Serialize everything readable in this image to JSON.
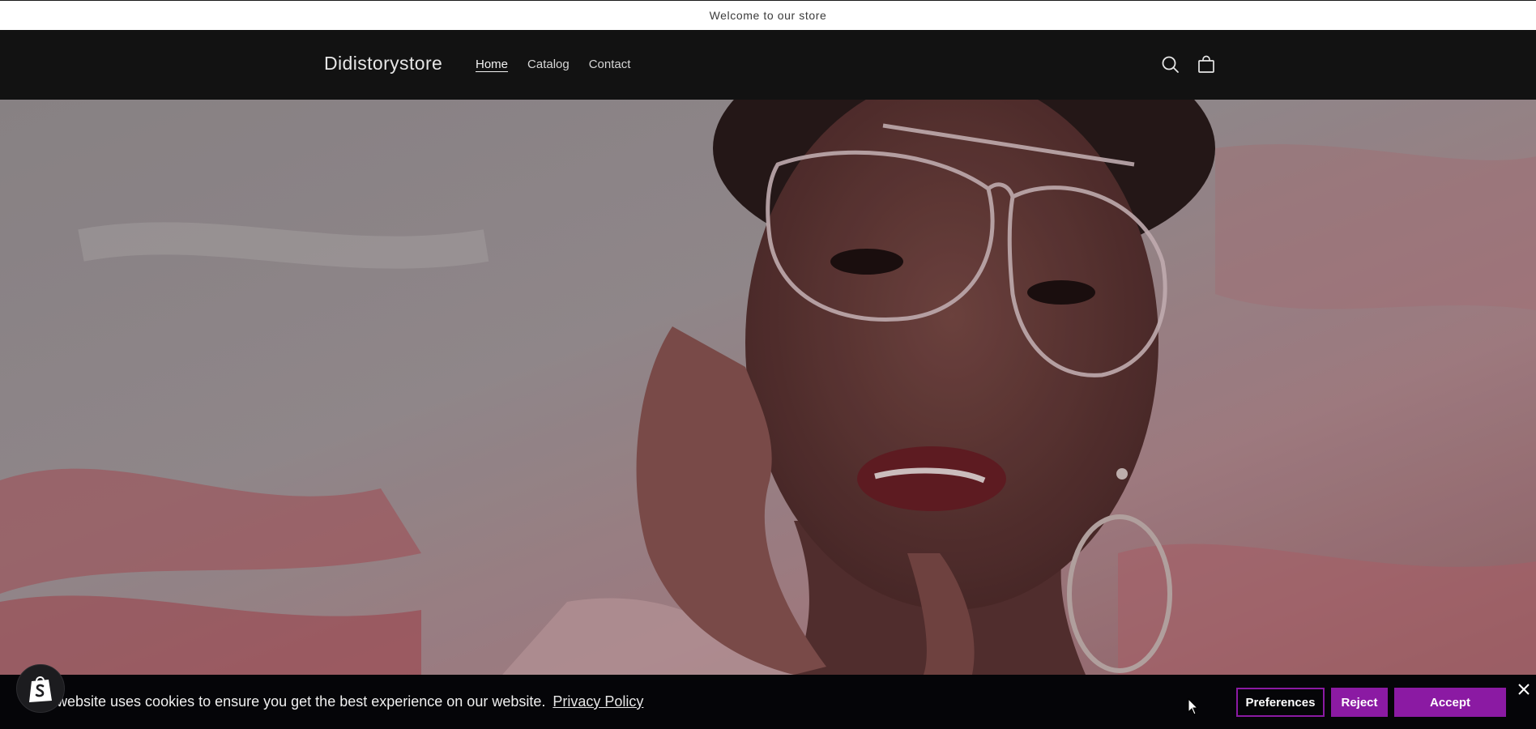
{
  "announcement": {
    "text": "Welcome to our store"
  },
  "header": {
    "brand": "Didistorystore",
    "nav": [
      {
        "label": "Home",
        "active": true
      },
      {
        "label": "Catalog",
        "active": false
      },
      {
        "label": "Contact",
        "active": false
      }
    ],
    "icons": [
      "search-icon",
      "cart-icon"
    ]
  },
  "hero": {
    "image": "portrait of woman with clear glasses and hoop earrings on pink-grey background"
  },
  "cookie_banner": {
    "text": "website uses cookies to ensure you get the best experience on our website.",
    "link": "Privacy Policy",
    "preferences_label": "Preferences",
    "reject_label": "Reject",
    "accept_label": "Accept",
    "accent_color": "#8b1aa3"
  }
}
